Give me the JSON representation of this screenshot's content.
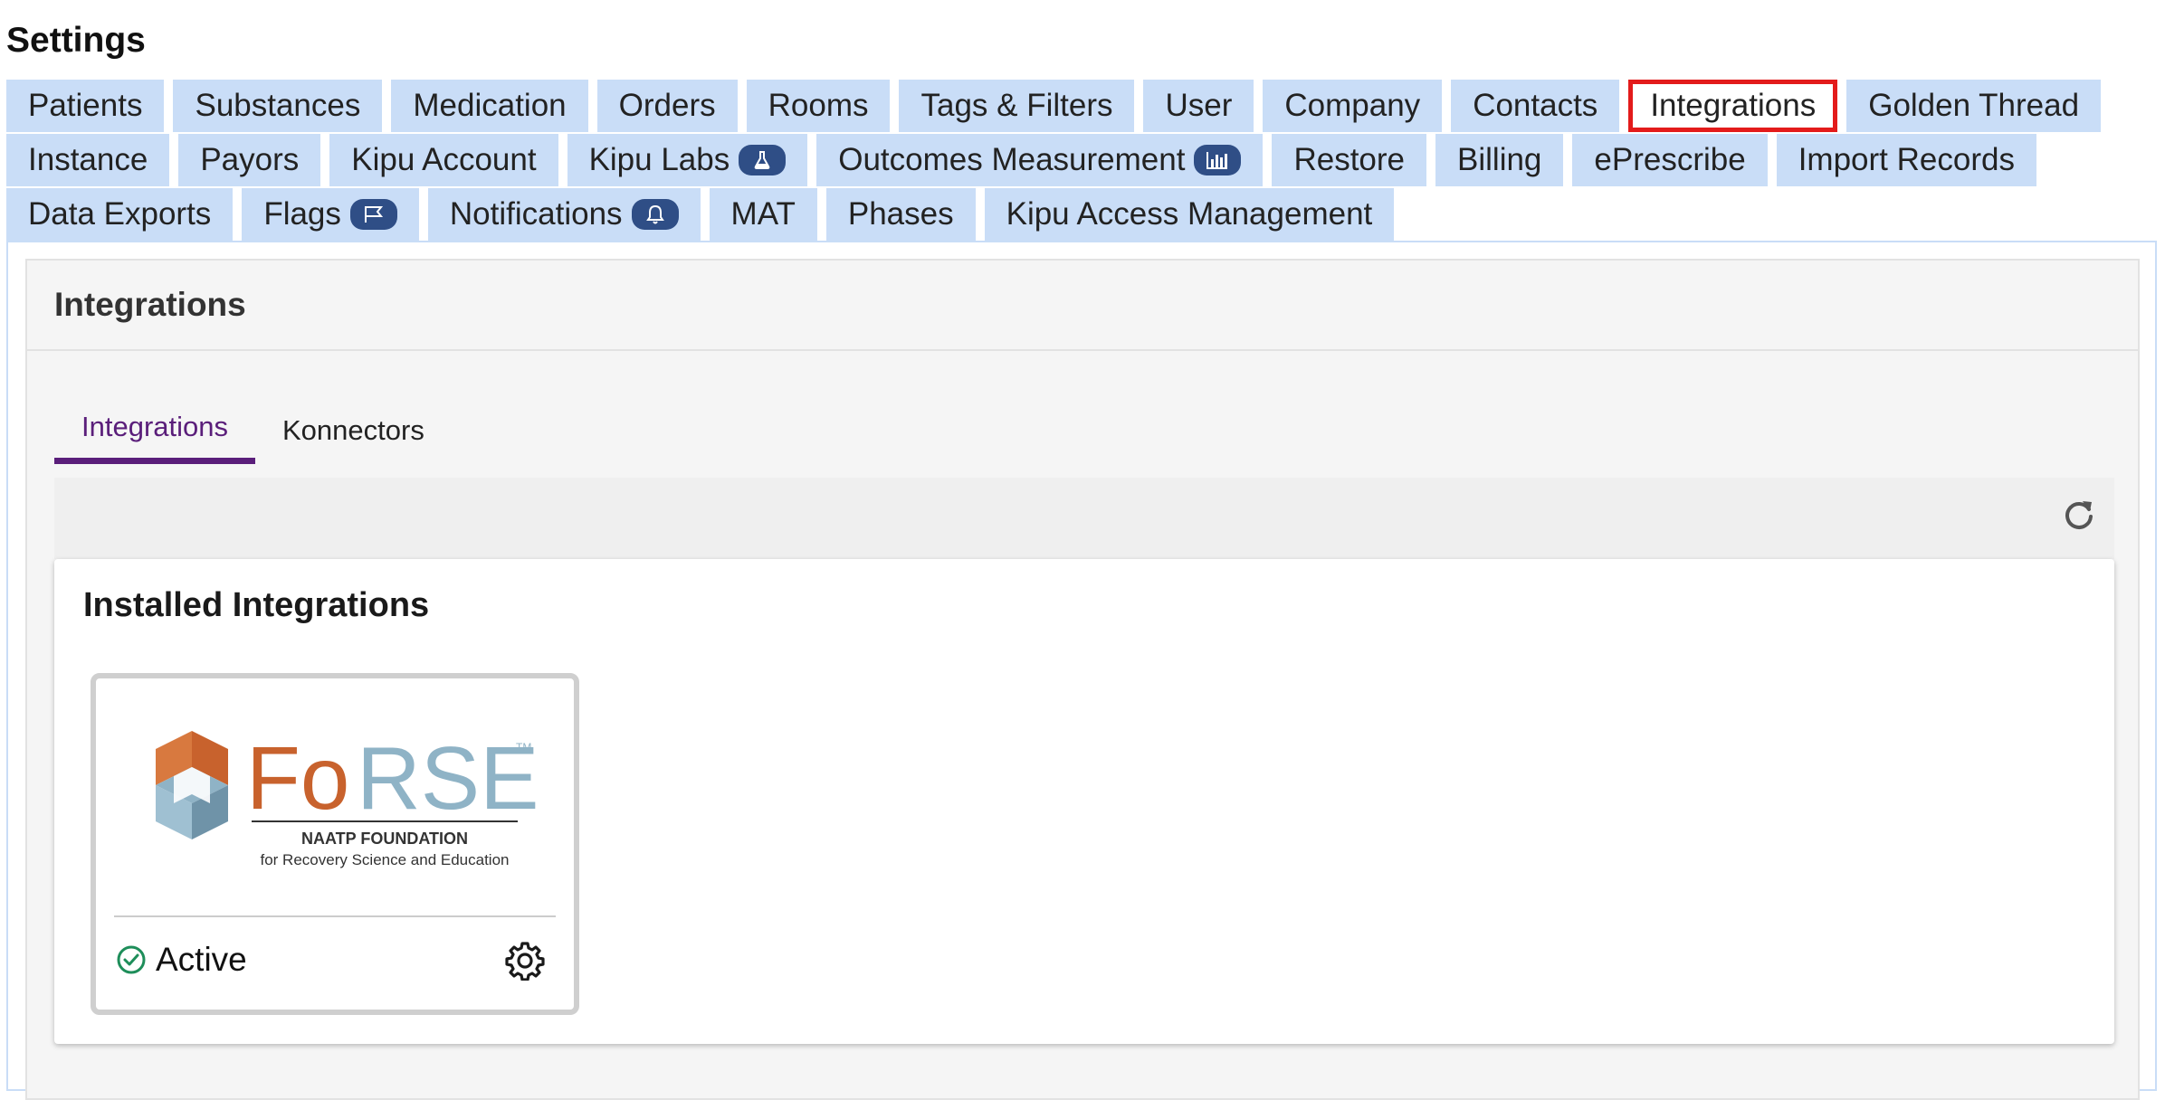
{
  "page": {
    "title": "Settings"
  },
  "tabs": {
    "row1": [
      {
        "label": "Patients"
      },
      {
        "label": "Substances"
      },
      {
        "label": "Medication"
      },
      {
        "label": "Orders"
      },
      {
        "label": "Rooms"
      },
      {
        "label": "Tags & Filters"
      },
      {
        "label": "User"
      },
      {
        "label": "Company"
      },
      {
        "label": "Contacts"
      },
      {
        "label": "Integrations",
        "selected": true
      },
      {
        "label": "Golden Thread"
      }
    ],
    "row2": [
      {
        "label": "Instance"
      },
      {
        "label": "Payors"
      },
      {
        "label": "Kipu Account"
      },
      {
        "label": "Kipu Labs",
        "badge_icon": "flask-icon"
      },
      {
        "label": "Outcomes Measurement",
        "badge_icon": "bar-chart-icon"
      },
      {
        "label": "Restore"
      },
      {
        "label": "Billing"
      },
      {
        "label": "ePrescribe"
      },
      {
        "label": "Import Records"
      }
    ],
    "row3": [
      {
        "label": "Data Exports"
      },
      {
        "label": "Flags",
        "badge_icon": "flag-icon"
      },
      {
        "label": "Notifications",
        "badge_icon": "bell-icon"
      },
      {
        "label": "MAT"
      },
      {
        "label": "Phases"
      },
      {
        "label": "Kipu Access Management"
      }
    ]
  },
  "panel": {
    "title": "Integrations",
    "subtabs": [
      {
        "label": "Integrations",
        "active": true
      },
      {
        "label": "Konnectors"
      }
    ],
    "toolbar": {
      "refresh_icon": "refresh-icon"
    },
    "installed": {
      "title": "Installed Integrations",
      "items": [
        {
          "logo_text": "FoRSE",
          "logo_tm": "TM",
          "logo_org": "NAATP FOUNDATION",
          "logo_tagline": "for Recovery Science and Education",
          "status": "Active",
          "status_icon": "check-circle-icon",
          "settings_icon": "gear-icon"
        }
      ]
    }
  },
  "colors": {
    "tab_bg": "#c9ddf7",
    "selected_outline": "#e31b1b",
    "subtab_active": "#5a1e7a",
    "badge_bg": "#2f4e86",
    "status_green": "#1e8e5a",
    "logo_orange": "#c8622d",
    "logo_blue": "#8fb3c6"
  }
}
